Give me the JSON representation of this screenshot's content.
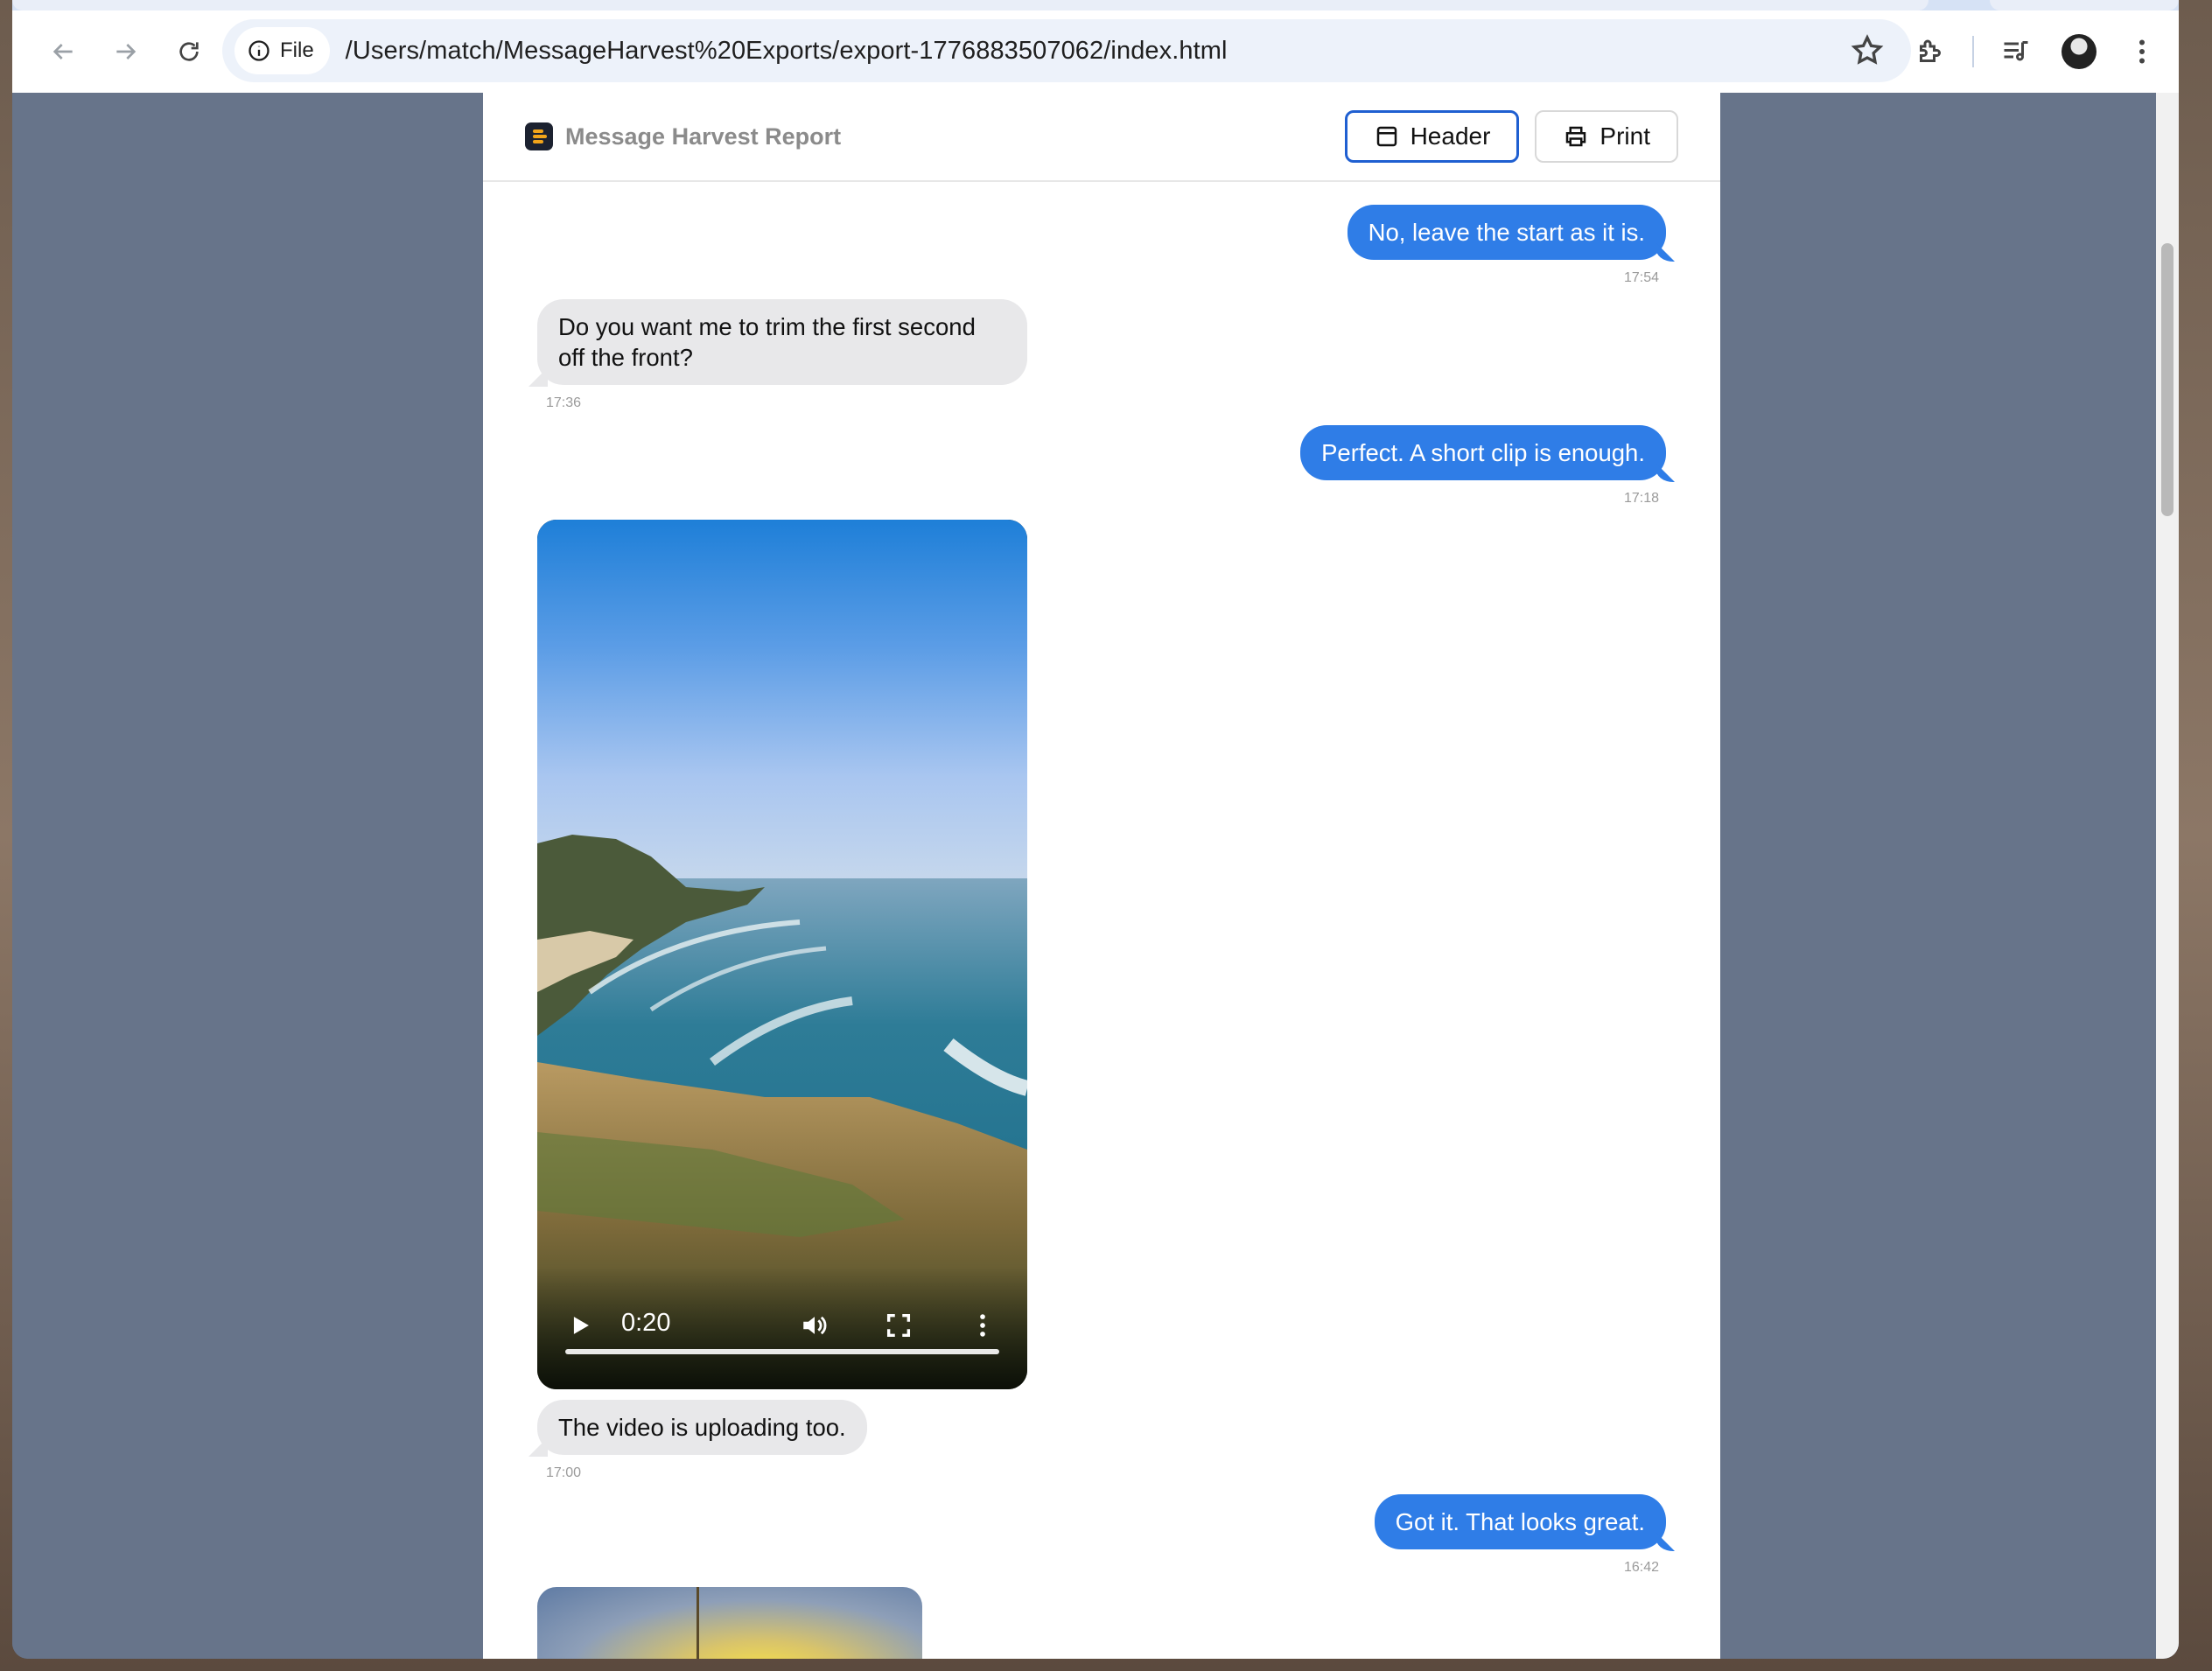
{
  "browser": {
    "chip_label": "File",
    "url": "/Users/match/MessageHarvest%20Exports/export-1776883507062/index.html"
  },
  "report": {
    "title": "Message Harvest Report",
    "buttons": {
      "header": "Header",
      "print": "Print"
    }
  },
  "messages": [
    {
      "direction": "out",
      "text": "No, leave the start as it is.",
      "time": "17:54"
    },
    {
      "direction": "in",
      "text": "Do you want me to trim the first second off the front?",
      "time": "17:36"
    },
    {
      "direction": "out",
      "text": "Perfect. A short clip is enough.",
      "time": "17:18"
    },
    {
      "direction": "in",
      "type": "video",
      "duration": "0:20"
    },
    {
      "direction": "in",
      "text": "The video is uploading too.",
      "time": "17:00"
    },
    {
      "direction": "out",
      "text": "Got it. That looks great.",
      "time": "16:42"
    },
    {
      "direction": "in",
      "type": "image"
    }
  ],
  "icons": {
    "back": "arrow-left-icon",
    "forward": "arrow-right-icon",
    "reload": "reload-icon",
    "info": "info-icon",
    "bookmark": "star-icon",
    "extensions": "puzzle-icon",
    "media": "media-queue-icon",
    "profile": "avatar",
    "menu": "kebab-menu-icon"
  },
  "colors": {
    "outgoing": "#2f7de7",
    "incoming": "#e8e8ea",
    "accent": "#1f5fd1"
  }
}
